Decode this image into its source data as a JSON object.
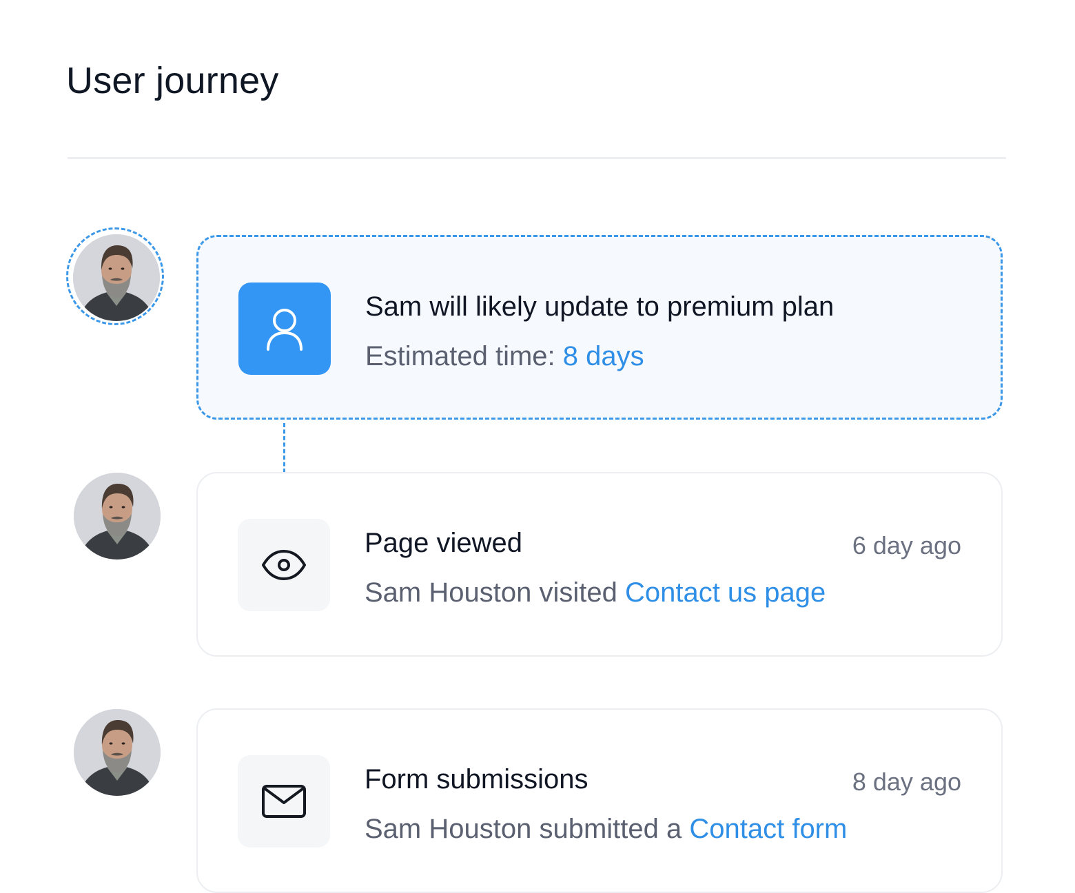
{
  "page": {
    "title": "User journey"
  },
  "colors": {
    "accent": "#3396f4",
    "link": "#2f8fe6",
    "dashed_border": "#3b97e8",
    "prediction_card_bg": "#f6f9fd",
    "icon_box_grey": "#f5f6f8"
  },
  "journey": {
    "prediction": {
      "icon": "user-icon",
      "title": "Sam will likely update to premium plan",
      "sub_prefix": "Estimated time: ",
      "sub_link": "8 days"
    },
    "events": [
      {
        "icon": "eye-icon",
        "title": "Page viewed",
        "time": "6 day ago",
        "sub_prefix": "Sam Houston visited ",
        "sub_link": "Contact us page"
      },
      {
        "icon": "mail-icon",
        "title": "Form submissions",
        "time": "8 day ago",
        "sub_prefix": "Sam Houston submitted a ",
        "sub_link": "Contact form"
      }
    ]
  }
}
